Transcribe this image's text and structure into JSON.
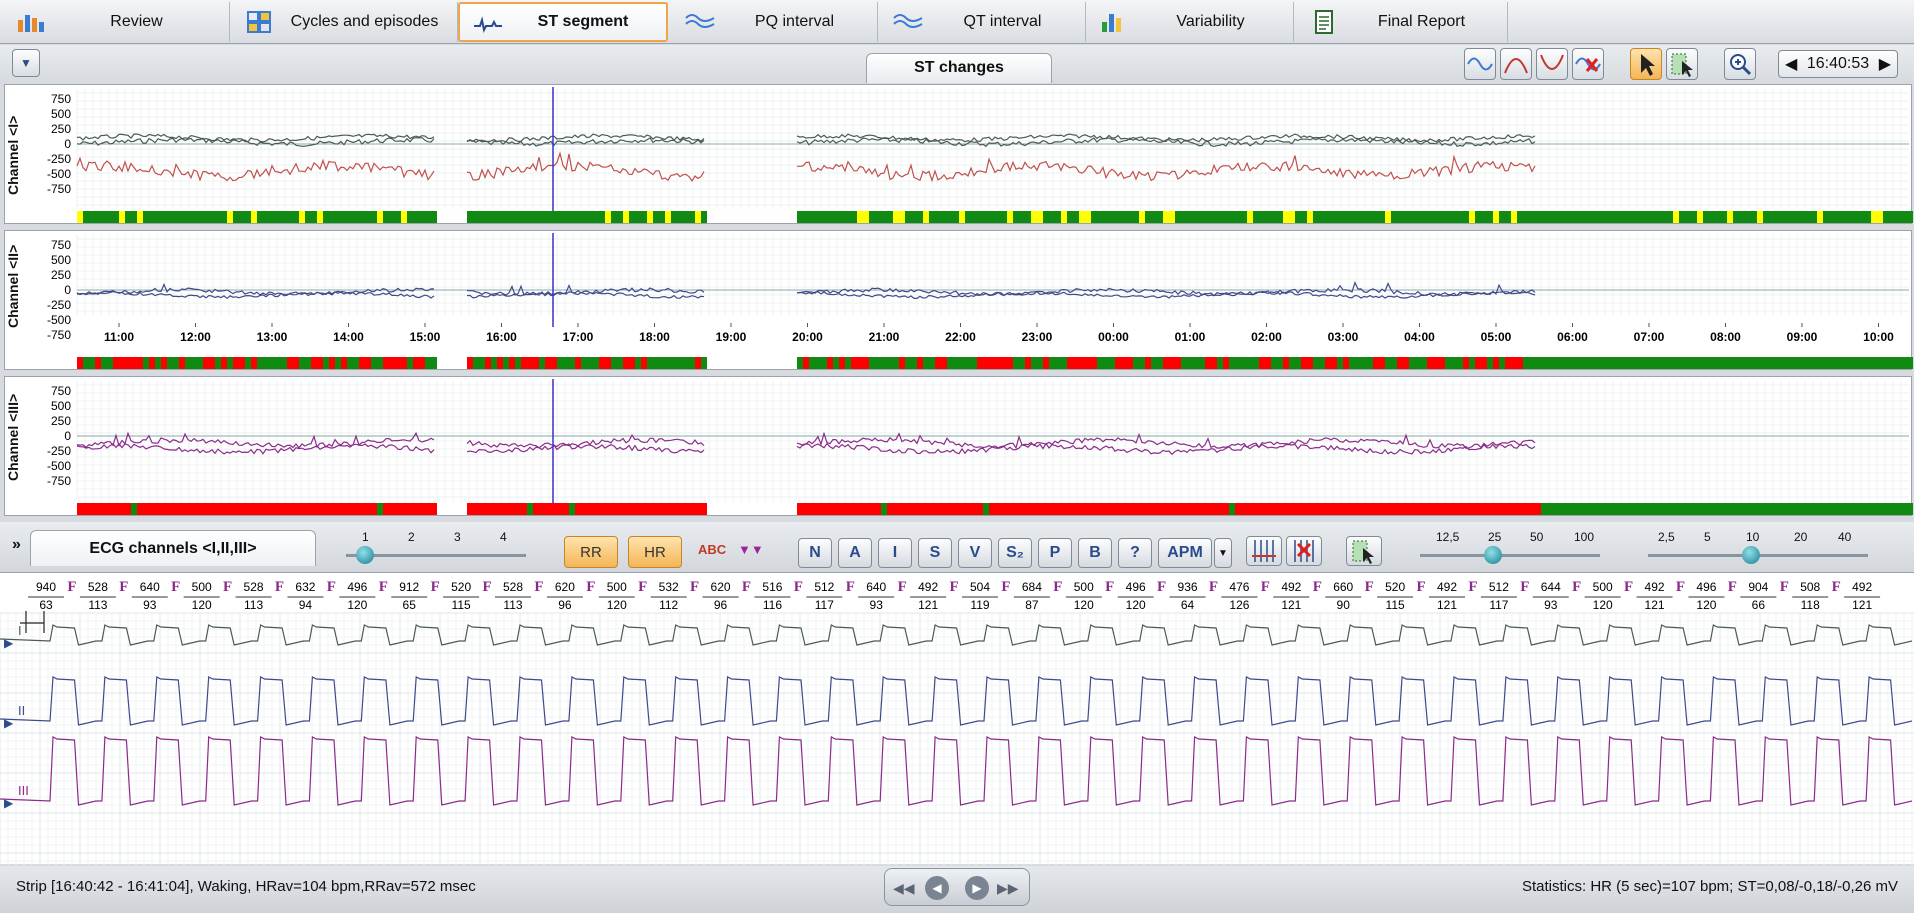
{
  "tabs": [
    {
      "label": "Review"
    },
    {
      "label": "Cycles and episodes"
    },
    {
      "label": "ST segment"
    },
    {
      "label": "PQ interval"
    },
    {
      "label": "QT interval"
    },
    {
      "label": "Variability"
    },
    {
      "label": "Final Report"
    }
  ],
  "subbar": {
    "title": "ST changes",
    "time": "16:40:53",
    "prev": "◀",
    "next": "▶",
    "menu": "▼"
  },
  "channels": [
    {
      "label": "Channel <I>"
    },
    {
      "label": "Channel <II>"
    },
    {
      "label": "Channel <III>"
    }
  ],
  "y_ticks": [
    "750",
    "500",
    "250",
    "0",
    "-250",
    "-500",
    "-750"
  ],
  "time_axis": [
    "11:00",
    "12:00",
    "13:00",
    "14:00",
    "15:00",
    "16:00",
    "17:00",
    "18:00",
    "19:00",
    "20:00",
    "21:00",
    "22:00",
    "23:00",
    "00:00",
    "01:00",
    "02:00",
    "03:00",
    "04:00",
    "05:00",
    "06:00",
    "07:00",
    "08:00",
    "09:00",
    "10:00"
  ],
  "ecg": {
    "title": "ECG channels <I,II,III>",
    "collapse": "»",
    "rr": "RR",
    "hr": "HR",
    "abc": "ABC",
    "beat_buttons": [
      "N",
      "A",
      "I",
      "S",
      "V",
      "S₂",
      "P",
      "B",
      "?",
      "APM"
    ],
    "scale1": [
      "1",
      "2",
      "3",
      "4"
    ],
    "scale2": [
      "12,5",
      "25",
      "50",
      "100"
    ],
    "scale3": [
      "2,5",
      "5",
      "10",
      "20",
      "40"
    ],
    "lead_labels": [
      "I",
      "II",
      "III"
    ],
    "annot_rr": [
      "940",
      "528",
      "640",
      "500",
      "528",
      "632",
      "496",
      "912",
      "520",
      "528",
      "620",
      "500",
      "532",
      "620",
      "516",
      "512",
      "640",
      "492",
      "504",
      "684",
      "500",
      "496",
      "936",
      "476",
      "492",
      "660",
      "520",
      "492",
      "512",
      "644",
      "500",
      "492",
      "496",
      "904",
      "508",
      "492"
    ],
    "annot_hr": [
      "63",
      "113",
      "93",
      "120",
      "113",
      "94",
      "120",
      "65",
      "115",
      "113",
      "96",
      "120",
      "112",
      "96",
      "116",
      "117",
      "93",
      "121",
      "119",
      "87",
      "120",
      "120",
      "64",
      "126",
      "121",
      "90",
      "115",
      "121",
      "117",
      "93",
      "120",
      "121",
      "120",
      "66",
      "118",
      "121"
    ],
    "beat_tag": "F"
  },
  "status": {
    "left": "Strip [16:40:42 - 16:41:04], Waking,  HRav=104 bpm,RRav=572 msec",
    "right": "Statistics: HR (5 sec)=107 bpm; ST=0,08/-0,18/-0,26 mV"
  },
  "colors": {
    "active_tab": "#f0a54a",
    "red": "#ff0000",
    "green": "#118a11",
    "yellow": "#ffff00",
    "cursor": "#3a2fd0",
    "ch1a": "#4a5a55",
    "ch1b": "#c0504d",
    "ch2": "#3e4a8a",
    "ch3": "#8a2a8a"
  }
}
